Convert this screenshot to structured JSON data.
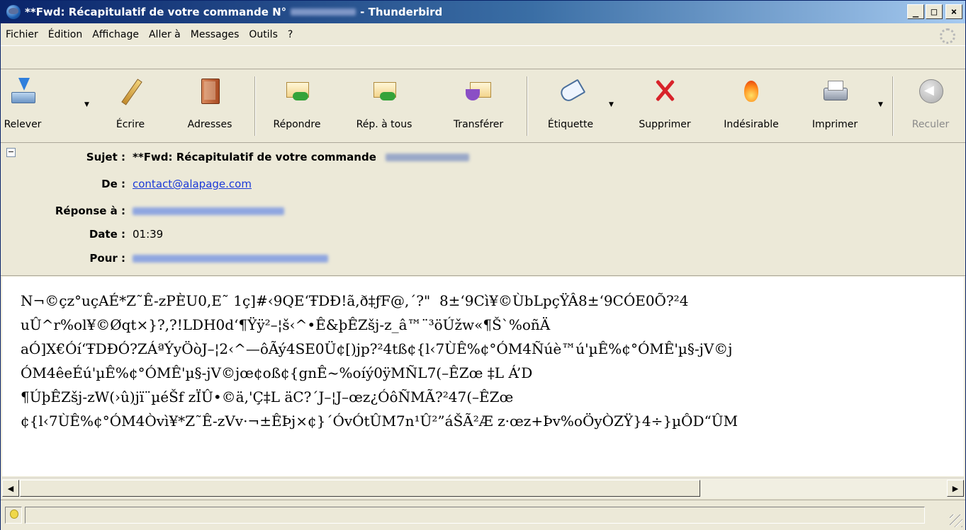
{
  "window": {
    "title_prefix": "**Fwd: Récapitulatif de votre commande N°",
    "title_suffix": "- Thunderbird",
    "buttons": {
      "minimize": "_",
      "maximize": "□",
      "close": "×"
    }
  },
  "menu": {
    "items": [
      {
        "label": "Fichier"
      },
      {
        "label": "Édition"
      },
      {
        "label": "Affichage"
      },
      {
        "label": "Aller à"
      },
      {
        "label": "Messages"
      },
      {
        "label": "Outils"
      },
      {
        "label": "?"
      }
    ]
  },
  "toolbar": {
    "relever": "Relever",
    "ecrire": "Écrire",
    "adresses": "Adresses",
    "repondre": "Répondre",
    "rep_tous": "Rép. à tous",
    "transferer": "Transférer",
    "etiquette": "Étiquette",
    "supprimer": "Supprimer",
    "indesirable": "Indésirable",
    "imprimer": "Imprimer",
    "reculer": "Reculer"
  },
  "headers": {
    "subject_label": "Sujet :",
    "subject_value": "**Fwd: Récapitulatif de votre commande",
    "from_label": "De :",
    "from_value": "contact@alapage.com",
    "reply_label": "Réponse à :",
    "date_label": "Date :",
    "date_value": "01:39",
    "to_label": "Pour :"
  },
  "body": {
    "lines": [
      "N¬©çz°uçAÉ*Z˜Ê-zPÈU0,E˜ 1ç]#‹9QE‘ŦDÐ!ã,ð‡ƒF@,´?\"  8±‘9Cì¥©ÙbLpçŸÂ8±‘9CÓE0Õ?²4",
      "uÛ^r%ol¥©Øqt×}?,?!LDH0d‘¶Ÿÿ²–¦š‹^•Ê&þÊZšj-z_â™¨³öÚžw«¶Š`%oñÄ",
      "aÓ]X€Óí‘ŦDÐÓ?ZÁªÝyÖòJ–¦2‹^—ôÃý4SE0Ü¢[)jp?²4tß¢{l‹7ÙÊ%¢°ÓM4Ñúè™ú'µÊ%¢°ÓMÊ'µ§-jV©j",
      "ÓM4êeÉú'µÊ%¢°ÓMÊ'µ§-jV©jœ¢oß¢{gnÊ~%oíý0ÿMÑL7(–ÊZœ ‡L Á’D",
      "¶ÚþÊZšj-zW(›û)jï¨µéŠf zÏÛ•©ä,'Ç‡L äC?´J–¦J–œz¿ÓôÑMÃ?²47(–ÊZœ",
      "¢{l‹7ÙÊ%¢°ÓM4Òvì¥*Z˜Ê-zVv·¬±ÊÞj×¢}´ÓvÓtÛM7n¹Û²”áŠÃ²Æ z·œz+Þv%oÖyÒZŸ}4÷}µÔD“ÛM"
    ]
  }
}
